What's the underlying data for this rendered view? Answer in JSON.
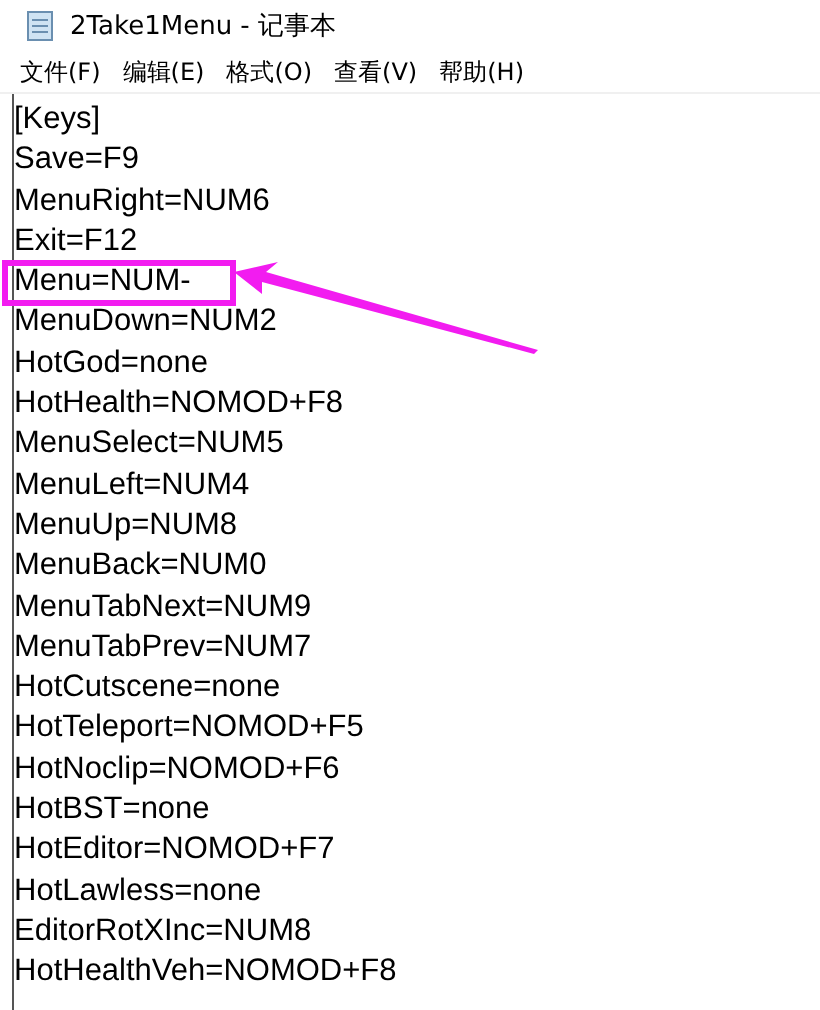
{
  "window": {
    "title": "2Take1Menu - 记事本"
  },
  "menu": [
    "文件(F)",
    "编辑(E)",
    "格式(O)",
    "查看(V)",
    "帮助(H)"
  ],
  "lines": [
    {
      "text": "[Keys]",
      "highlighted": false
    },
    {
      "text": "Save=F9",
      "highlighted": false
    },
    {
      "text": "MenuRight=NUM6",
      "highlighted": false
    },
    {
      "text": "Exit=F12",
      "highlighted": false
    },
    {
      "text": "Menu=NUM-",
      "highlighted": true
    },
    {
      "text": "MenuDown=NUM2",
      "highlighted": false
    },
    {
      "text": "HotGod=none",
      "highlighted": false
    },
    {
      "text": "HotHealth=NOMOD+F8",
      "highlighted": false
    },
    {
      "text": "MenuSelect=NUM5",
      "highlighted": false
    },
    {
      "text": "MenuLeft=NUM4",
      "highlighted": false
    },
    {
      "text": "MenuUp=NUM8",
      "highlighted": false
    },
    {
      "text": "MenuBack=NUM0",
      "highlighted": false
    },
    {
      "text": "MenuTabNext=NUM9",
      "highlighted": false
    },
    {
      "text": "MenuTabPrev=NUM7",
      "highlighted": false
    },
    {
      "text": "HotCutscene=none",
      "highlighted": false
    },
    {
      "text": "HotTeleport=NOMOD+F5",
      "highlighted": false
    },
    {
      "text": "HotNoclip=NOMOD+F6",
      "highlighted": false
    },
    {
      "text": "HotBST=none",
      "highlighted": false
    },
    {
      "text": "HotEditor=NOMOD+F7",
      "highlighted": false
    },
    {
      "text": "HotLawless=none",
      "highlighted": false
    },
    {
      "text": "EditorRotXInc=NUM8",
      "highlighted": false
    },
    {
      "text": "HotHealthVeh=NOMOD+F8",
      "highlighted": false
    }
  ]
}
